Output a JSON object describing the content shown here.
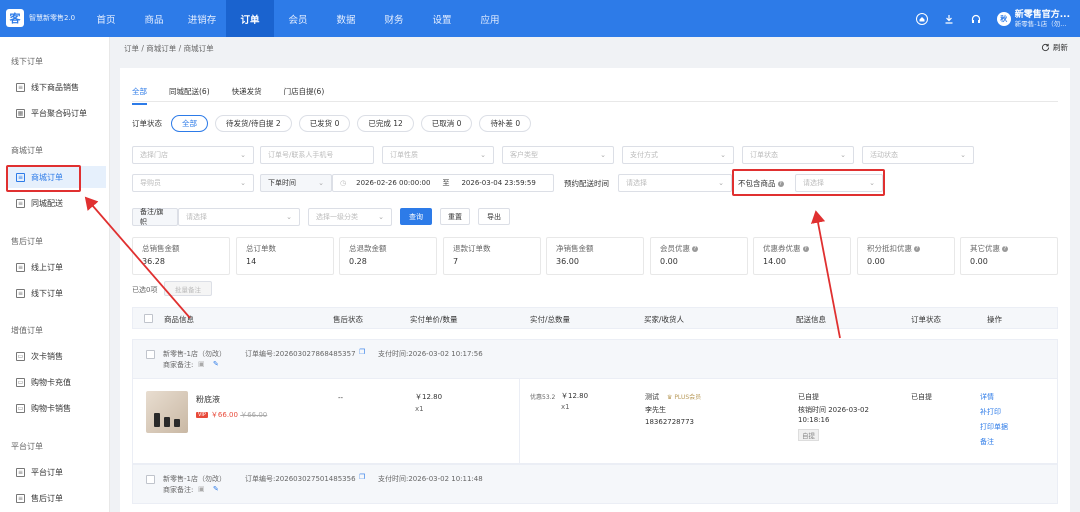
{
  "app": {
    "logo_text": "智慧新零售2.0",
    "logo_glyph": "客"
  },
  "nav": [
    "首页",
    "商品",
    "进销存",
    "订单",
    "会员",
    "数据",
    "财务",
    "设置",
    "应用"
  ],
  "user": {
    "name": "新零售官方...",
    "sub": "新零售-1店（勿...",
    "avatar": "秋"
  },
  "sidebar": {
    "sections": [
      {
        "title": "线下订单",
        "items": [
          "线下商品销售",
          "平台聚合码订单"
        ]
      },
      {
        "title": "商城订单",
        "items": [
          "商城订单",
          "同城配送"
        ]
      },
      {
        "title": "售后订单",
        "items": [
          "线上订单",
          "线下订单"
        ]
      },
      {
        "title": "增值订单",
        "items": [
          "次卡销售",
          "购物卡充值",
          "购物卡销售"
        ]
      },
      {
        "title": "平台订单",
        "items": [
          "平台订单",
          "售后订单"
        ]
      }
    ]
  },
  "breadcrumb": "订单 / 商城订单 / 商城订单",
  "refresh_label": "刷新",
  "tabs": [
    "全部",
    "同城配送(6)",
    "快递发货",
    "门店自提(6)"
  ],
  "status": {
    "label": "订单状态",
    "pills": [
      "全部",
      "待发货/待自提 2",
      "已发货 0",
      "已完成 12",
      "已取消 0",
      "待补差 0"
    ]
  },
  "filters": {
    "row1": [
      "选择门店",
      "订单号/联系人手机号",
      "订单性质",
      "客户类型",
      "支付方式",
      "订单状态",
      "活动状态"
    ],
    "guide": "导购员",
    "time_type": "下单时间",
    "date_start": "2026-02-26 00:00:00",
    "date_sep": "至",
    "date_end": "2026-03-04 23:59:59",
    "delivery_label": "预约配送时间",
    "delivery_placeholder": "请选择",
    "exclude_label": "不包含商品",
    "exclude_placeholder": "请选择",
    "remark_type": "备注/旗帜",
    "remark_placeholder": "请选择",
    "category_placeholder": "选择一级分类",
    "search_btn": "查询",
    "reset_btn": "重置",
    "export_btn": "导出"
  },
  "stats": [
    {
      "label": "总销售金额",
      "value": "36.28"
    },
    {
      "label": "总订单数",
      "value": "14"
    },
    {
      "label": "总退款金额",
      "value": "0.28"
    },
    {
      "label": "退款订单数",
      "value": "7"
    },
    {
      "label": "净销售金额",
      "value": "36.00"
    },
    {
      "label": "会员优惠",
      "value": "0.00"
    },
    {
      "label": "优惠券优惠",
      "value": "14.00"
    },
    {
      "label": "积分抵扣优惠",
      "value": "0.00"
    },
    {
      "label": "其它优惠",
      "value": "0.00"
    }
  ],
  "selection": {
    "count_text": "已选0项",
    "batch_btn": "批量备注"
  },
  "table": {
    "headers": [
      "商品信息",
      "售后状态",
      "实付单价/数量",
      "实付/总数量",
      "买家/收货人",
      "配送信息",
      "订单状态",
      "操作"
    ]
  },
  "orders": [
    {
      "store": "新零售-1店（勿改）",
      "order_no": "订单编号:202603027868485357",
      "pay_time": "支付时间:2026-03-02 10:17:56",
      "remark": "商家备注:",
      "product": "粉底液",
      "vip_badge": "VIP",
      "price": "￥66.00",
      "orig_price": "￥66.00",
      "after_sale": "--",
      "unit_price": "￥12.80",
      "qty": "x1",
      "discount": "优惠53.2",
      "paid_total": "￥12.80",
      "paid_qty": "x1",
      "buyer": "测试",
      "member_tag": "PLUS会员",
      "receiver": "李先生",
      "phone": "18362728773",
      "delivery_type": "已自提",
      "verify_time": "核销时间 2026-03-02",
      "verify_time2": "10:18:16",
      "delivery_tag": "自提",
      "status": "已自提",
      "actions": [
        "详情",
        "补打印",
        "打印单据",
        "备注"
      ]
    },
    {
      "store": "新零售-1店（勿改）",
      "order_no": "订单编号:202603027501485356",
      "pay_time": "支付时间:2026-03-02 10:11:48",
      "remark": "商家备注:"
    }
  ],
  "colors": {
    "primary": "#2d7be8",
    "annotation": "#e03030",
    "price": "#e84a3a"
  }
}
